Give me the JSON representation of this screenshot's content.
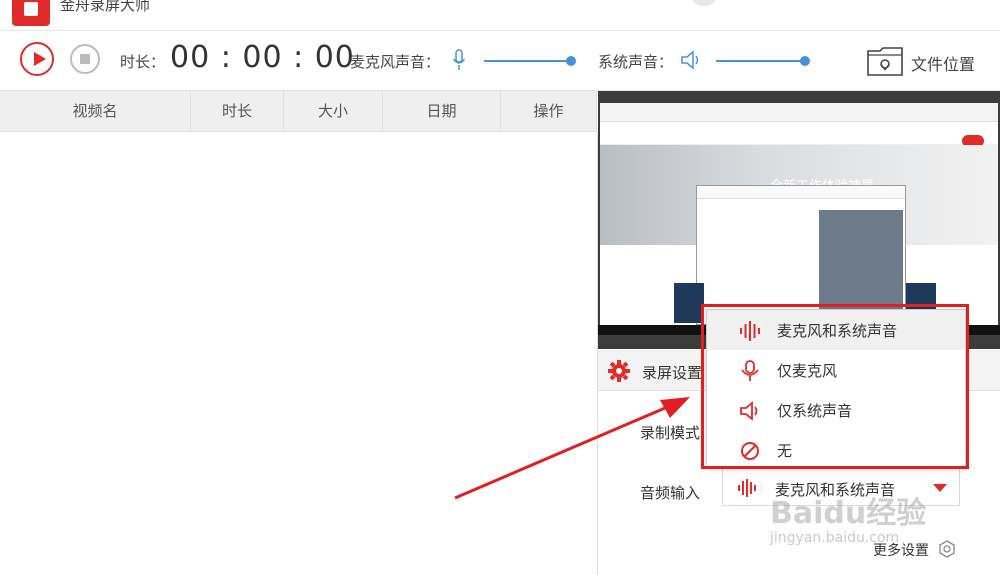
{
  "app": {
    "title": "金舟录屏大师"
  },
  "toolbar": {
    "duration_label": "时长：",
    "duration_value": "00 : 00 : 00",
    "mic_label": "麦克风声音：",
    "system_label": "系统声音：",
    "file_location_label": "文件位置"
  },
  "list": {
    "columns": [
      "视频名",
      "时长",
      "大小",
      "日期",
      "操作"
    ]
  },
  "preview": {
    "hero_text": "全新工作体验神器"
  },
  "settings": {
    "title": "录屏设置",
    "record_mode_label": "录制模式",
    "audio_input_label": "音频输入",
    "audio_input_value": "麦克风和系统声音",
    "more_label": "更多设置"
  },
  "dropdown": {
    "options": [
      "麦克风和系统声音",
      "仅麦克风",
      "仅系统声音",
      "无"
    ],
    "selected": "麦克风和系统声音"
  },
  "watermark": {
    "main": "Baidu经验",
    "sub": "jingyan.baidu.com"
  },
  "colors": {
    "accent": "#e02b2b",
    "slider": "#4a90d9",
    "annotation": "#e02020"
  }
}
